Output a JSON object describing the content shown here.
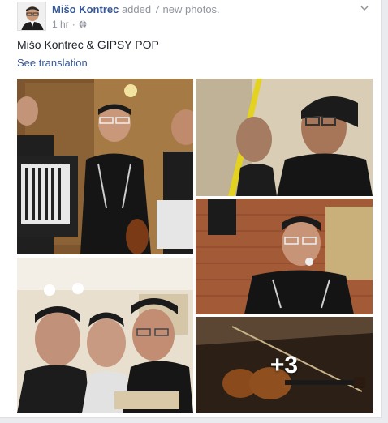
{
  "post": {
    "author": "Mišo Kontrec",
    "action": " added 7 new photos.",
    "time": "1 hr",
    "caption": "Mišo Kontrec & GIPSY POP",
    "see_translation": "See translation"
  },
  "photos": {
    "more_count": "+3"
  },
  "colors": {
    "link": "#365899",
    "meta": "#90949c",
    "text": "#1d2129",
    "background": "#e9ebee"
  },
  "icons": {
    "privacy": "globe-icon",
    "menu": "chevron-down-icon"
  }
}
